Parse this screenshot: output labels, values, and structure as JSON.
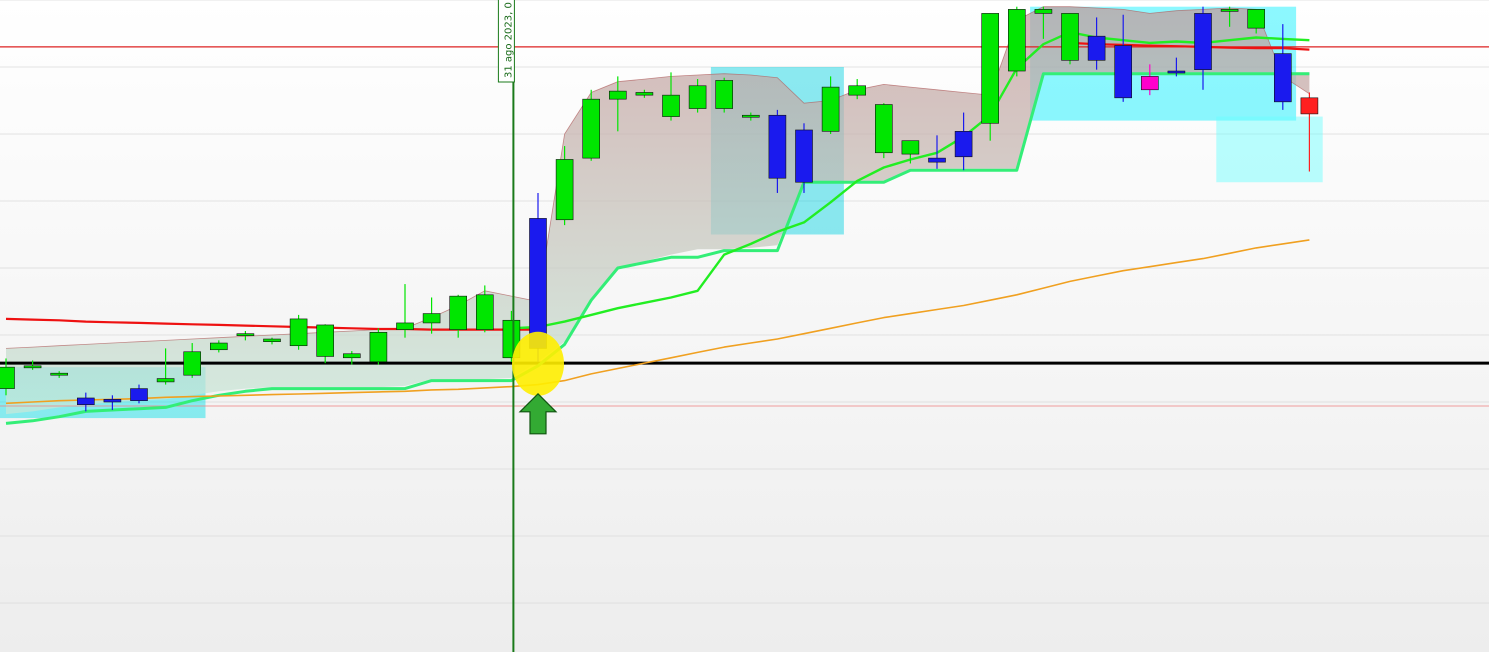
{
  "chart_data": {
    "type": "candlestick",
    "title": "",
    "xlabel": "",
    "ylabel": "",
    "ylim": [
      0,
      100
    ],
    "grid": true,
    "legend": "none",
    "marker": {
      "label": "31 ago 2023, 0",
      "index": 19,
      "note": "signal",
      "color": "#1a7a1a"
    },
    "candles": [
      {
        "o": 42.0,
        "h": 46.5,
        "l": 41.0,
        "c": 45.2,
        "color": "#00e600"
      },
      {
        "o": 45.1,
        "h": 46.2,
        "l": 44.8,
        "c": 45.4,
        "color": "#00e600"
      },
      {
        "o": 44.0,
        "h": 44.6,
        "l": 43.6,
        "c": 44.3,
        "color": "#00e600"
      },
      {
        "o": 40.6,
        "h": 41.4,
        "l": 38.6,
        "c": 39.6,
        "color": "#1a1aee"
      },
      {
        "o": 40.4,
        "h": 41.0,
        "l": 38.8,
        "c": 40.0,
        "color": "#1a1aee"
      },
      {
        "o": 42.0,
        "h": 42.6,
        "l": 39.8,
        "c": 40.2,
        "color": "#1a1aee"
      },
      {
        "o": 43.0,
        "h": 48.0,
        "l": 42.6,
        "c": 43.5,
        "color": "#00e600"
      },
      {
        "o": 44.0,
        "h": 48.8,
        "l": 43.6,
        "c": 47.5,
        "color": "#00e600"
      },
      {
        "o": 47.8,
        "h": 49.2,
        "l": 47.4,
        "c": 48.8,
        "color": "#00e600"
      },
      {
        "o": 50.0,
        "h": 50.6,
        "l": 49.2,
        "c": 50.2,
        "color": "#00e600"
      },
      {
        "o": 49.0,
        "h": 49.6,
        "l": 48.6,
        "c": 49.4,
        "color": "#00e600"
      },
      {
        "o": 48.4,
        "h": 53.0,
        "l": 47.8,
        "c": 52.4,
        "color": "#00e600"
      },
      {
        "o": 46.8,
        "h": 51.6,
        "l": 45.8,
        "c": 51.5,
        "color": "#00e600"
      },
      {
        "o": 46.6,
        "h": 47.6,
        "l": 45.6,
        "c": 47.2,
        "color": "#00e600"
      },
      {
        "o": 46.0,
        "h": 51.0,
        "l": 45.6,
        "c": 50.4,
        "color": "#00e600"
      },
      {
        "o": 50.8,
        "h": 57.6,
        "l": 49.6,
        "c": 51.8,
        "color": "#00e600"
      },
      {
        "o": 51.8,
        "h": 55.6,
        "l": 50.2,
        "c": 53.2,
        "color": "#00e600"
      },
      {
        "o": 50.8,
        "h": 56.0,
        "l": 49.6,
        "c": 55.8,
        "color": "#00e600"
      },
      {
        "o": 50.8,
        "h": 57.4,
        "l": 50.4,
        "c": 56.0,
        "color": "#00e600"
      },
      {
        "o": 46.6,
        "h": 53.6,
        "l": 46.0,
        "c": 52.2,
        "color": "#00e600"
      },
      {
        "o": 48.0,
        "h": 71.2,
        "l": 46.0,
        "c": 67.4,
        "color": "#1a1aee"
      },
      {
        "o": 67.2,
        "h": 78.2,
        "l": 66.4,
        "c": 76.2,
        "color": "#00e600"
      },
      {
        "o": 76.4,
        "h": 86.6,
        "l": 76.0,
        "c": 85.2,
        "color": "#00e600"
      },
      {
        "o": 85.2,
        "h": 88.6,
        "l": 80.4,
        "c": 86.4,
        "color": "#00e600"
      },
      {
        "o": 85.8,
        "h": 86.6,
        "l": 85.4,
        "c": 86.2,
        "color": "#00e600"
      },
      {
        "o": 82.6,
        "h": 89.2,
        "l": 82.0,
        "c": 85.8,
        "color": "#00e600"
      },
      {
        "o": 83.8,
        "h": 88.2,
        "l": 83.2,
        "c": 87.2,
        "color": "#00e600"
      },
      {
        "o": 83.8,
        "h": 88.4,
        "l": 83.2,
        "c": 88.0,
        "color": "#00e600"
      },
      {
        "o": 82.6,
        "h": 83.2,
        "l": 82.0,
        "c": 82.8,
        "color": "#00e600"
      },
      {
        "o": 82.8,
        "h": 83.6,
        "l": 71.2,
        "c": 73.4,
        "color": "#1a1aee"
      },
      {
        "o": 80.6,
        "h": 81.6,
        "l": 71.2,
        "c": 72.8,
        "color": "#1a1aee"
      },
      {
        "o": 80.4,
        "h": 88.6,
        "l": 80.0,
        "c": 87.0,
        "color": "#00e600"
      },
      {
        "o": 85.8,
        "h": 88.2,
        "l": 85.2,
        "c": 87.2,
        "color": "#00e600"
      },
      {
        "o": 77.2,
        "h": 84.6,
        "l": 76.4,
        "c": 84.4,
        "color": "#00e600"
      },
      {
        "o": 77.0,
        "h": 78.4,
        "l": 75.6,
        "c": 79.0,
        "color": "#00e600"
      },
      {
        "o": 76.4,
        "h": 79.8,
        "l": 74.8,
        "c": 75.8,
        "color": "#1a1aee"
      },
      {
        "o": 80.4,
        "h": 83.2,
        "l": 74.6,
        "c": 76.6,
        "color": "#1a1aee"
      },
      {
        "o": 81.6,
        "h": 98.0,
        "l": 79.0,
        "c": 98.0,
        "color": "#00e600"
      },
      {
        "o": 89.4,
        "h": 99.0,
        "l": 88.6,
        "c": 98.6,
        "color": "#00e600"
      },
      {
        "o": 98.0,
        "h": 99.0,
        "l": 94.2,
        "c": 98.6,
        "color": "#00e600"
      },
      {
        "o": 91.0,
        "h": 98.0,
        "l": 90.4,
        "c": 98.0,
        "color": "#00e600"
      },
      {
        "o": 94.6,
        "h": 97.4,
        "l": 89.6,
        "c": 91.0,
        "color": "#1a1aee"
      },
      {
        "o": 93.2,
        "h": 97.8,
        "l": 84.8,
        "c": 85.4,
        "color": "#1a1aee"
      },
      {
        "o": 88.6,
        "h": 90.4,
        "l": 85.8,
        "c": 86.6,
        "color": "#ff00cc"
      },
      {
        "o": 89.2,
        "h": 91.4,
        "l": 88.6,
        "c": 89.4,
        "color": "#1a1aee"
      },
      {
        "o": 98.0,
        "h": 99.0,
        "l": 86.6,
        "c": 89.6,
        "color": "#1a1aee"
      },
      {
        "o": 98.4,
        "h": 99.0,
        "l": 96.0,
        "c": 98.6,
        "color": "#00e600"
      },
      {
        "o": 95.8,
        "h": 98.0,
        "l": 95.0,
        "c": 98.6,
        "color": "#00e600"
      },
      {
        "o": 92.0,
        "h": 96.4,
        "l": 83.6,
        "c": 84.8,
        "color": "#1a1aee"
      },
      {
        "o": 83.0,
        "h": 86.2,
        "l": 74.4,
        "c": 85.4,
        "color": "#ff2020"
      }
    ],
    "levels": [
      {
        "y": 93.0,
        "color": "#dd2222",
        "width": 1.2
      },
      {
        "y": 45.8,
        "color": "#000000",
        "width": 3
      },
      {
        "y": 39.4,
        "color": "#f08080",
        "width": 0.8
      }
    ],
    "lines": [
      {
        "name": "",
        "color": "#ee1111",
        "width": 2.2,
        "values": [
          52.4,
          52.3,
          52.2,
          52.0,
          51.9,
          51.8,
          51.7,
          51.6,
          51.5,
          51.4,
          51.3,
          51.2,
          51.1,
          51.0,
          50.9,
          50.9,
          50.8,
          50.8,
          50.8,
          50.8,
          50.8,
          null,
          null,
          null,
          null,
          null,
          null,
          null,
          null,
          null,
          null,
          null,
          null,
          null,
          null,
          null,
          null,
          null,
          null,
          null,
          93.6,
          93.4,
          93.3,
          93.2,
          93.1,
          93.0,
          92.9,
          92.8,
          92.8,
          92.6
        ]
      },
      {
        "name": "",
        "color": "#33ee77",
        "width": 3,
        "values": [
          36.8,
          37.2,
          37.8,
          38.6,
          38.8,
          39.0,
          39.2,
          40.2,
          41.0,
          41.6,
          42.0,
          42.0,
          42.0,
          42.0,
          42.0,
          42.0,
          43.2,
          43.2,
          43.2,
          43.2,
          45.4,
          48.6,
          55.2,
          60.0,
          60.8,
          61.6,
          61.6,
          62.6,
          62.6,
          62.6,
          72.8,
          72.8,
          72.8,
          72.8,
          74.6,
          74.6,
          74.6,
          74.6,
          74.6,
          89.0,
          89.0,
          89.0,
          89.0,
          89.0,
          89.0,
          89.0,
          89.0,
          89.0,
          89.0,
          89.0
        ]
      },
      {
        "name": "",
        "color": "#22ee22",
        "width": 2.4,
        "values": [
          null,
          null,
          null,
          null,
          null,
          null,
          null,
          null,
          null,
          null,
          null,
          null,
          null,
          null,
          null,
          null,
          null,
          null,
          null,
          51.0,
          51.2,
          52.0,
          53.0,
          54.0,
          54.8,
          55.6,
          56.6,
          62.0,
          63.6,
          65.4,
          66.8,
          69.8,
          73.0,
          75.0,
          76.2,
          77.2,
          79.6,
          82.8,
          89.8,
          93.4,
          95.2,
          94.4,
          94.0,
          93.6,
          93.8,
          93.6,
          94.0,
          94.4,
          94.2,
          94.0
        ]
      },
      {
        "name": "",
        "color": "#f0a020",
        "width": 1.6,
        "values": [
          39.8,
          40.0,
          40.2,
          40.3,
          40.4,
          40.5,
          40.7,
          40.8,
          40.9,
          41.0,
          41.1,
          41.2,
          41.3,
          41.4,
          41.5,
          41.6,
          41.8,
          41.9,
          42.1,
          42.3,
          42.6,
          43.2,
          44.2,
          45.0,
          45.8,
          46.6,
          47.4,
          48.2,
          48.8,
          49.4,
          50.2,
          51.0,
          51.8,
          52.6,
          53.2,
          53.8,
          54.4,
          55.2,
          56.0,
          57.0,
          58.0,
          58.8,
          59.6,
          60.2,
          60.8,
          61.4,
          62.2,
          63.0,
          63.6,
          64.2
        ]
      }
    ],
    "band": {
      "upper": [
        48.0,
        48.2,
        48.4,
        48.6,
        48.8,
        49.0,
        49.2,
        49.4,
        49.6,
        49.8,
        50.0,
        50.2,
        50.4,
        50.6,
        50.8,
        51.0,
        52.6,
        54.4,
        56.6,
        55.8,
        55.0,
        80.0,
        86.2,
        87.8,
        88.2,
        88.6,
        88.8,
        89.0,
        88.8,
        88.4,
        84.6,
        85.0,
        86.6,
        87.4,
        87.0,
        86.6,
        86.2,
        85.8,
        97.0,
        99.0,
        99.0,
        98.8,
        98.6,
        98.0,
        98.4,
        98.6,
        98.8,
        98.6,
        88.6,
        86.0
      ],
      "lower": [
        38.2,
        38.6,
        39.2,
        39.6,
        40.0,
        40.2,
        40.4,
        41.0,
        41.6,
        42.0,
        42.2,
        42.2,
        42.2,
        42.2,
        42.2,
        42.4,
        43.4,
        43.4,
        43.4,
        43.6,
        46.0,
        49.0,
        55.4,
        60.2,
        61.0,
        62.0,
        62.8,
        62.8,
        63.0,
        63.4,
        73.0,
        73.0,
        73.0,
        73.0,
        74.8,
        74.8,
        74.8,
        74.8,
        74.8,
        89.2,
        89.2,
        89.2,
        89.2,
        89.2,
        89.2,
        89.2,
        89.2,
        89.2,
        89.2,
        89.2
      ],
      "fill_top": "#c49a9a",
      "fill_bottom": "#c8e8d8"
    },
    "zones": [
      {
        "from": 0,
        "to": 7,
        "top": 45.2,
        "bottom": 37.6,
        "color": "#00e0e8"
      },
      {
        "from": 27,
        "to": 31,
        "top": 90.0,
        "bottom": 65.0,
        "color": "#00d0e0"
      },
      {
        "from": 39,
        "to": 48,
        "top": 99.0,
        "bottom": 82.0,
        "color": "#00f0ff"
      },
      {
        "from": 46,
        "to": 49,
        "top": 82.6,
        "bottom": 72.8,
        "color": "#66ffff"
      }
    ]
  }
}
